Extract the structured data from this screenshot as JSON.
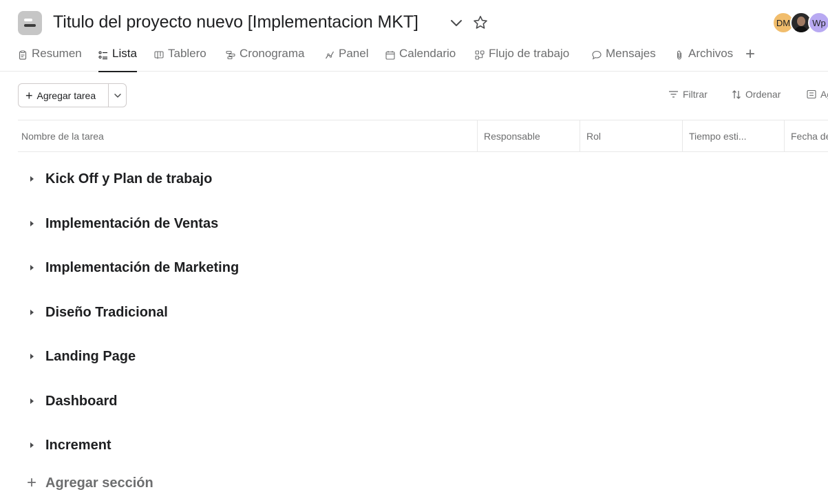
{
  "project": {
    "title": "Titulo del proyecto nuevo [Implementacion MKT]",
    "icon": "project-list-icon",
    "members": [
      {
        "initials": "DM",
        "color": "#f1bd6c"
      },
      {
        "initials": "",
        "kind": "photo"
      },
      {
        "initials": "Wp",
        "color": "#b8a9f2"
      }
    ]
  },
  "tabs": [
    {
      "label": "Resumen",
      "icon": "clipboard-icon"
    },
    {
      "label": "Lista",
      "icon": "list-icon",
      "active": true
    },
    {
      "label": "Tablero",
      "icon": "board-icon"
    },
    {
      "label": "Cronograma",
      "icon": "timeline-icon"
    },
    {
      "label": "Panel",
      "icon": "chart-icon"
    },
    {
      "label": "Calendario",
      "icon": "calendar-icon"
    },
    {
      "label": "Flujo de trabajo",
      "icon": "workflow-icon"
    },
    {
      "label": "Mensajes",
      "icon": "message-icon"
    },
    {
      "label": "Archivos",
      "icon": "paperclip-icon"
    }
  ],
  "toolbar": {
    "add_task_label": "Agregar tarea",
    "filter_label": "Filtrar",
    "sort_label": "Ordenar",
    "group_label": "Ag"
  },
  "columns": [
    "Nombre de la tarea",
    "Responsable",
    "Rol",
    "Tiempo esti...",
    "Fecha de"
  ],
  "sections": [
    "Kick Off y Plan de trabajo",
    "Implementación de Ventas",
    "Implementación de Marketing",
    "Diseño Tradicional",
    "Landing Page",
    "Dashboard",
    "Increment"
  ],
  "add_section_label": "Agregar sección",
  "colors": {
    "text": "#1e1f21",
    "muted": "#6d6e6f",
    "border": "#e8e8e8"
  }
}
